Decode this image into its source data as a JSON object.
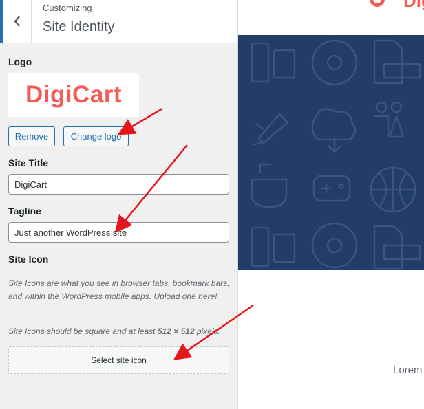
{
  "header": {
    "action": "Customizing",
    "title": "Site Identity",
    "back_icon": "chevron-left-icon"
  },
  "logo": {
    "label": "Logo",
    "image_text": "DigiCart",
    "remove_label": "Remove",
    "change_label": "Change logo"
  },
  "site_title": {
    "label": "Site Title",
    "value": "DigiCart"
  },
  "tagline": {
    "label": "Tagline",
    "value": "Just another WordPress site"
  },
  "site_icon": {
    "label": "Site Icon",
    "description_1": "Site Icons are what you see in browser tabs, bookmark bars, and within the WordPress mobile apps. Upload one here!",
    "description_2_pre": "Site Icons should be square and at least ",
    "description_2_size": "512 × 512",
    "description_2_post": " pixels.",
    "select_label": "Select site icon"
  },
  "preview": {
    "logo_text": "Digi",
    "body_text": "Lorem"
  },
  "colors": {
    "accent": "#2271b1",
    "brand": "#f45b55",
    "hero": "#223d69",
    "arrow": "#e4161b"
  }
}
